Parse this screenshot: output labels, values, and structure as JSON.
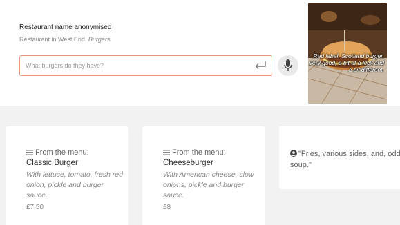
{
  "restaurant": {
    "name": "Restaurant name anonymised",
    "location": "Restaurant in West End.",
    "category": "Burgers"
  },
  "search": {
    "placeholder": "What burgers do they have?",
    "enter_icon": "enter-icon",
    "mic_icon": "microphone-icon"
  },
  "photo": {
    "caption": "Red label: Scotland burger, very good, a bit of a kick and a bit different."
  },
  "cards": [
    {
      "source": "From the menu:",
      "title": "Classic Burger",
      "description": "With lettuce, tomato, fresh red onion, pickle and burger sauce.",
      "price": "£7.50"
    },
    {
      "source": "From the menu:",
      "title": "Cheeseburger",
      "description": "With American cheese, slow onions, pickle and burger sauce.",
      "price": "£8"
    },
    {
      "quote": "\"Fries, various sides, and, oddly, soup.\""
    }
  ],
  "colors": {
    "accent": "#e9967a",
    "background": "#f2f2f2"
  }
}
